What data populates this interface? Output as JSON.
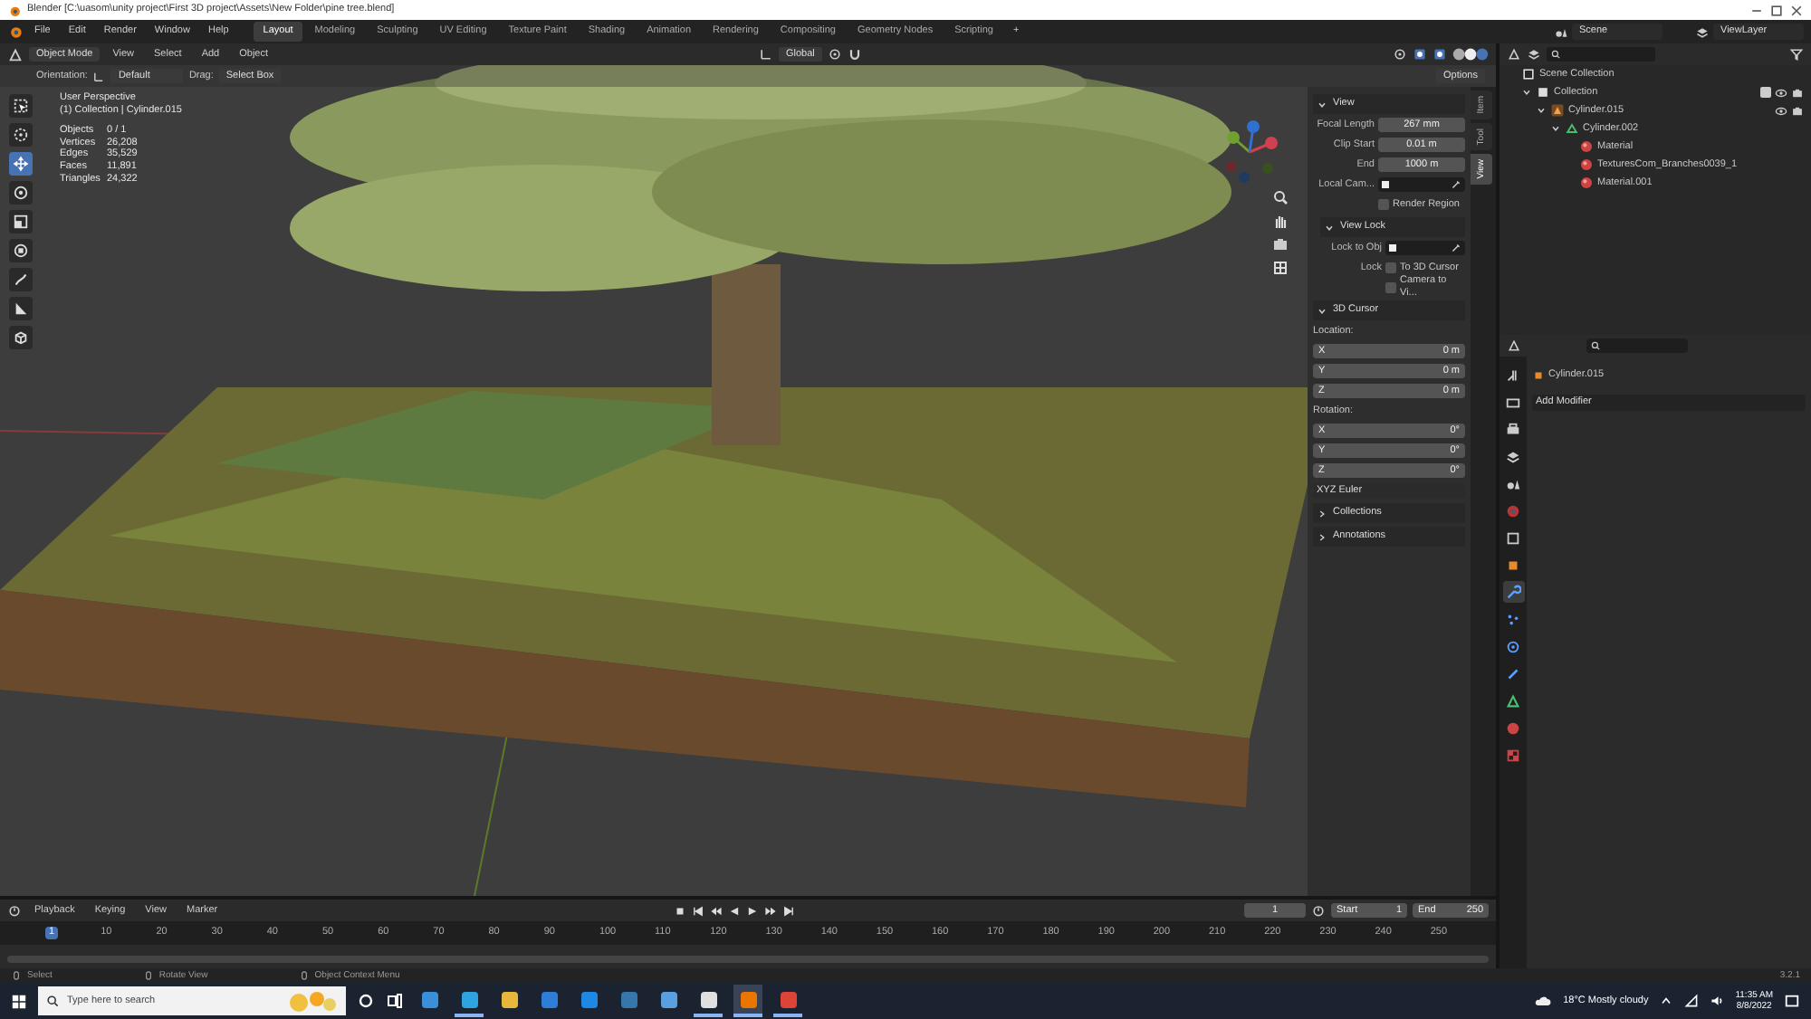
{
  "window": {
    "title": "Blender [C:\\uasom\\unity project\\First 3D project\\Assets\\New Folder\\pine tree.blend]"
  },
  "menu": [
    "File",
    "Edit",
    "Render",
    "Window",
    "Help"
  ],
  "workspaces": [
    {
      "label": "Layout",
      "selected": true
    },
    {
      "label": "Modeling",
      "selected": false
    },
    {
      "label": "Sculpting",
      "selected": false
    },
    {
      "label": "UV Editing",
      "selected": false
    },
    {
      "label": "Texture Paint",
      "selected": false
    },
    {
      "label": "Shading",
      "selected": false
    },
    {
      "label": "Animation",
      "selected": false
    },
    {
      "label": "Rendering",
      "selected": false
    },
    {
      "label": "Compositing",
      "selected": false
    },
    {
      "label": "Geometry Nodes",
      "selected": false
    },
    {
      "label": "Scripting",
      "selected": false
    }
  ],
  "add_workspace": "+",
  "scene": "Scene",
  "view_layer": "ViewLayer",
  "header": {
    "mode": "Object Mode",
    "menus": [
      "View",
      "Select",
      "Add",
      "Object"
    ],
    "orientation": "Global",
    "options": "Options"
  },
  "tool_settings": {
    "orientation_label": "Orientation:",
    "orientation": "Default",
    "drag_label": "Drag:",
    "drag": "Select Box"
  },
  "toolbar": [
    {
      "kind": "select",
      "selected": false
    },
    {
      "kind": "cursor",
      "selected": false
    },
    {
      "kind": "move",
      "selected": true
    },
    {
      "kind": "rotate",
      "selected": false
    },
    {
      "kind": "scale",
      "selected": false
    },
    {
      "kind": "transform",
      "selected": false
    },
    {
      "kind": "annotate",
      "selected": false
    },
    {
      "kind": "measure",
      "selected": false
    },
    {
      "kind": "add_cube",
      "selected": false
    }
  ],
  "viewport_info": {
    "perspective": "User Perspective",
    "collection": "(1) Collection | Cylinder.015",
    "stats": [
      {
        "label": "Objects",
        "value": "0 / 1"
      },
      {
        "label": "Vertices",
        "value": "26,208"
      },
      {
        "label": "Edges",
        "value": "35,529"
      },
      {
        "label": "Faces",
        "value": "11,891"
      },
      {
        "label": "Triangles",
        "value": "24,322"
      }
    ]
  },
  "sidebar": {
    "tabs": [
      {
        "label": "Item",
        "selected": false
      },
      {
        "label": "Tool",
        "selected": false
      },
      {
        "label": "View",
        "selected": true
      }
    ],
    "panels": [
      {
        "title": "View",
        "expanded": true,
        "sub": false,
        "rows": [
          {
            "kind": "field",
            "label": "Focal Length",
            "value": "267 mm"
          },
          {
            "kind": "field",
            "label": "Clip Start",
            "value": "0.01 m"
          },
          {
            "kind": "field",
            "label": "End",
            "value": "1000 m"
          },
          {
            "kind": "picker",
            "label": "Local Cam..."
          },
          {
            "kind": "check",
            "text": "Render Region",
            "checked": false
          }
        ]
      },
      {
        "title": "View Lock",
        "expanded": true,
        "sub": true,
        "rows": [
          {
            "kind": "picker",
            "label": "Lock to Obj"
          },
          {
            "kind": "check",
            "label": "Lock",
            "text": "To 3D Cursor",
            "checked": false
          },
          {
            "kind": "check",
            "text": "Camera to Vi...",
            "checked": false
          }
        ]
      },
      {
        "title": "3D Cursor",
        "expanded": true,
        "sub": false,
        "rows": [
          {
            "kind": "heading",
            "text": "Location:"
          },
          {
            "kind": "axis",
            "label": "X",
            "value": "0 m"
          },
          {
            "kind": "axis",
            "label": "Y",
            "value": "0 m"
          },
          {
            "kind": "axis",
            "label": "Z",
            "value": "0 m"
          },
          {
            "kind": "heading",
            "text": "Rotation:"
          },
          {
            "kind": "axis",
            "label": "X",
            "value": "0°"
          },
          {
            "kind": "axis",
            "label": "Y",
            "value": "0°"
          },
          {
            "kind": "axis",
            "label": "Z",
            "value": "0°"
          },
          {
            "kind": "dropdown",
            "text": "XYZ Euler"
          }
        ]
      },
      {
        "title": "Collections",
        "expanded": false,
        "sub": false
      },
      {
        "title": "Annotations",
        "expanded": false,
        "sub": false
      }
    ]
  },
  "outliner": {
    "tree": [
      {
        "kind": "scene_collection",
        "label": "Scene Collection",
        "children": [
          {
            "kind": "collection",
            "label": "Collection",
            "expanded": true,
            "toggles": true,
            "checked": true,
            "children": [
              {
                "kind": "object",
                "label": "Cylinder.015",
                "expanded": true,
                "toggles": true,
                "children": [
                  {
                    "kind": "mesh",
                    "label": "Cylinder.002",
                    "expanded": true,
                    "children": [
                      {
                        "kind": "material",
                        "label": "Material"
                      },
                      {
                        "kind": "material",
                        "label": "TexturesCom_Branches0039_1"
                      },
                      {
                        "kind": "material",
                        "label": "Material.001"
                      }
                    ]
                  }
                ]
              }
            ]
          }
        ]
      }
    ]
  },
  "properties": {
    "object": "Cylinder.015",
    "modifier_menu": "Add Modifier",
    "tabs": [
      {
        "kind": "tool",
        "selected": false
      },
      {
        "kind": "render",
        "selected": false
      },
      {
        "kind": "output",
        "selected": false
      },
      {
        "kind": "view_layer",
        "selected": false
      },
      {
        "kind": "scene",
        "selected": false
      },
      {
        "kind": "world",
        "selected": false
      },
      {
        "kind": "collection",
        "selected": false
      },
      {
        "kind": "object",
        "selected": false
      },
      {
        "kind": "modifiers",
        "selected": true
      },
      {
        "kind": "particles",
        "selected": false
      },
      {
        "kind": "physics",
        "selected": false
      },
      {
        "kind": "constraints",
        "selected": false
      },
      {
        "kind": "data",
        "selected": false
      },
      {
        "kind": "material",
        "selected": false
      },
      {
        "kind": "texture",
        "selected": false
      }
    ]
  },
  "timeline": {
    "menus": [
      "Playback",
      "Keying",
      "View",
      "Marker"
    ],
    "current_frame": "1",
    "start_label": "Start",
    "start": "1",
    "end_label": "End",
    "end": "250",
    "cursor_frame": "1",
    "ticks": [
      "10",
      "20",
      "30",
      "40",
      "50",
      "60",
      "70",
      "80",
      "90",
      "100",
      "110",
      "120",
      "130",
      "140",
      "150",
      "160",
      "170",
      "180",
      "190",
      "200",
      "210",
      "220",
      "230",
      "240",
      "250"
    ]
  },
  "status_bar": {
    "hints": [
      "Select",
      "Rotate View",
      "Object Context Menu"
    ],
    "version": "3.2.1"
  },
  "taskbar": {
    "search_placeholder": "Type here to search",
    "apps": [
      {
        "color": "#3a8fd9",
        "running": false,
        "selected": false
      },
      {
        "color": "#2fa3e0",
        "running": true,
        "selected": false
      },
      {
        "color": "#e8b63a",
        "running": false,
        "selected": false
      },
      {
        "color": "#2e7dd6",
        "running": false,
        "selected": false
      },
      {
        "color": "#1e88e5",
        "running": false,
        "selected": false
      },
      {
        "color": "#3776ab",
        "running": false,
        "selected": false
      },
      {
        "color": "#5aa0e0",
        "running": false,
        "selected": false
      },
      {
        "color": "#e0e0e0",
        "running": true,
        "selected": false
      },
      {
        "color": "#ea7600",
        "running": true,
        "selected": true
      },
      {
        "color": "#db4437",
        "running": true,
        "selected": false
      }
    ],
    "weather": "18°C  Mostly cloudy",
    "time": "11:35 AM",
    "date": "8/8/2022"
  }
}
